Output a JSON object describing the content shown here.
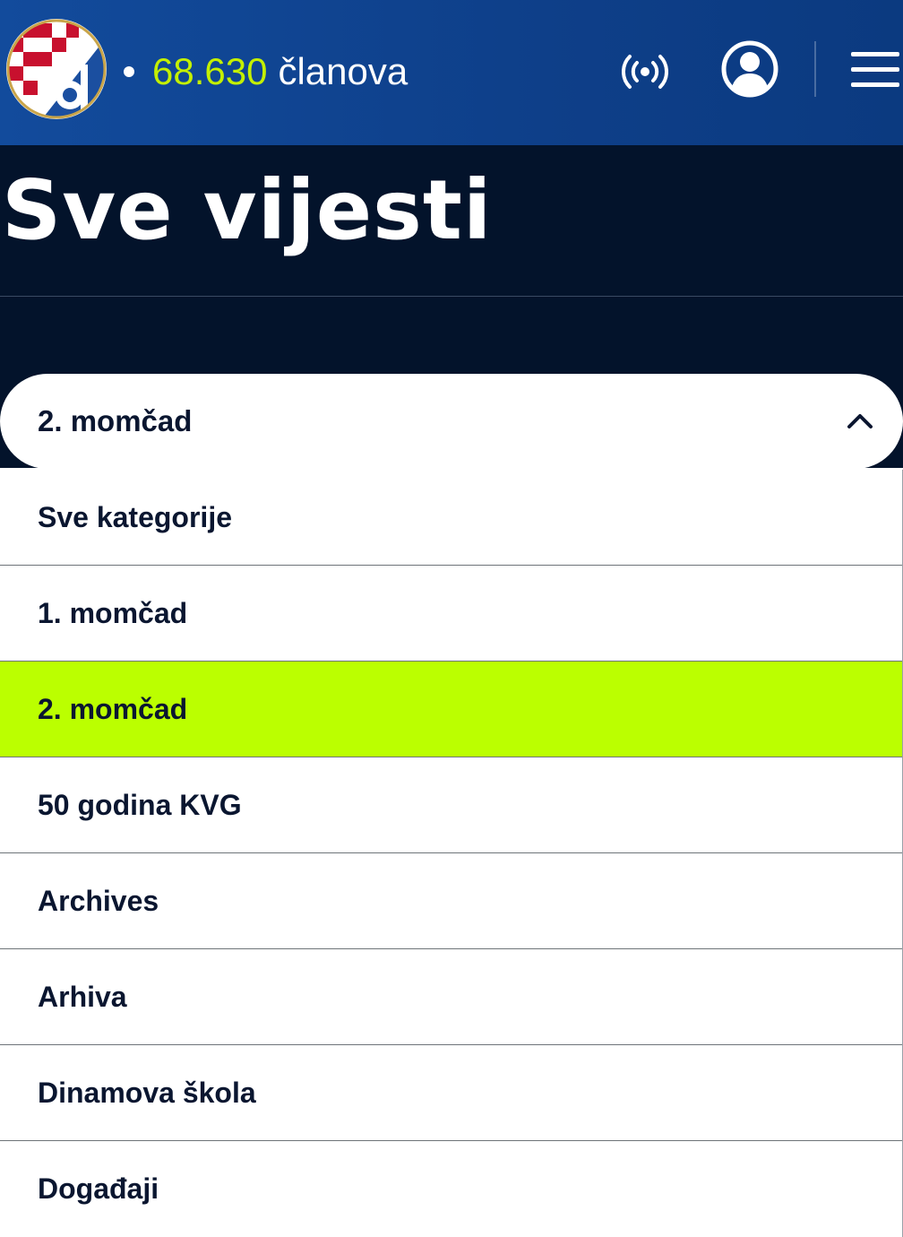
{
  "header": {
    "member_count": "68.630",
    "member_label": "članova",
    "icons": [
      "club-logo",
      "live-broadcast-icon",
      "user-account-icon",
      "menu-icon"
    ],
    "colors": {
      "header_blue": "#0e3f89",
      "accent_lime": "#c4f000",
      "dark_navy": "#03132b"
    }
  },
  "page": {
    "title": "Sve vijesti"
  },
  "category_select": {
    "selected": "2. momčad",
    "options": [
      "Sve kategorije",
      "1. momčad",
      "2. momčad",
      "50 godina KVG",
      "Archives",
      "Arhiva",
      "Dinamova škola",
      "Događaji"
    ],
    "selected_index": 2,
    "highlight_color": "#bbff00"
  }
}
